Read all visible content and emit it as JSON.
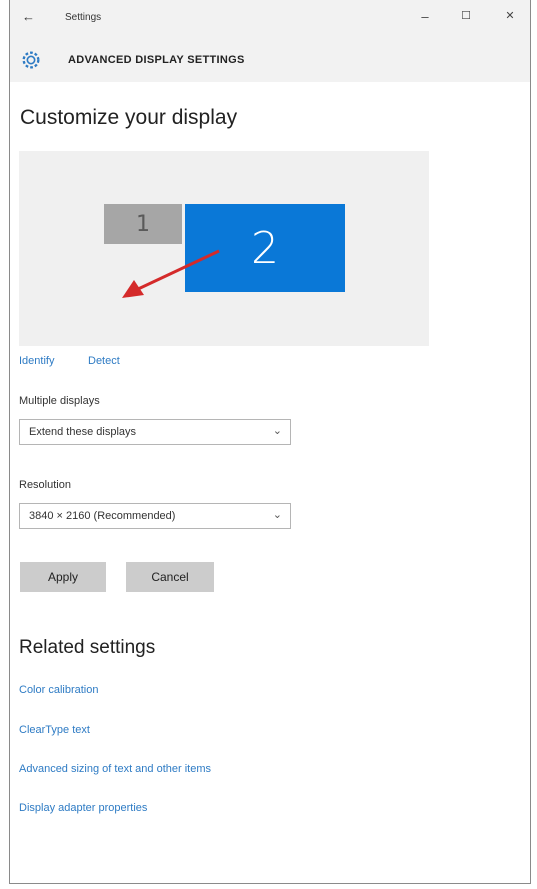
{
  "window": {
    "title": "Settings",
    "back_icon": "back-arrow-icon",
    "minimize": "–",
    "maximize": "☐",
    "close": "✕"
  },
  "header": {
    "icon": "gear-icon",
    "title": "ADVANCED DISPLAY SETTINGS"
  },
  "main": {
    "title": "Customize your display",
    "monitors": [
      {
        "label": "1",
        "color": "#a6a6a6"
      },
      {
        "label": "2",
        "color": "#0a78d7",
        "selected": true
      }
    ],
    "annotation_arrow_color": "#d42a2a",
    "identify_link": "Identify",
    "detect_link": "Detect",
    "multiple_displays": {
      "label": "Multiple displays",
      "value": "Extend these displays"
    },
    "resolution": {
      "label": "Resolution",
      "value": "3840 × 2160 (Recommended)"
    },
    "apply_button": "Apply",
    "cancel_button": "Cancel"
  },
  "related": {
    "title": "Related settings",
    "links": [
      "Color calibration",
      "ClearType text",
      "Advanced sizing of text and other items",
      "Display adapter properties"
    ]
  },
  "colors": {
    "accent": "#0a78d7",
    "link": "#2e7bc4",
    "header_bg": "#f2f2f2"
  }
}
